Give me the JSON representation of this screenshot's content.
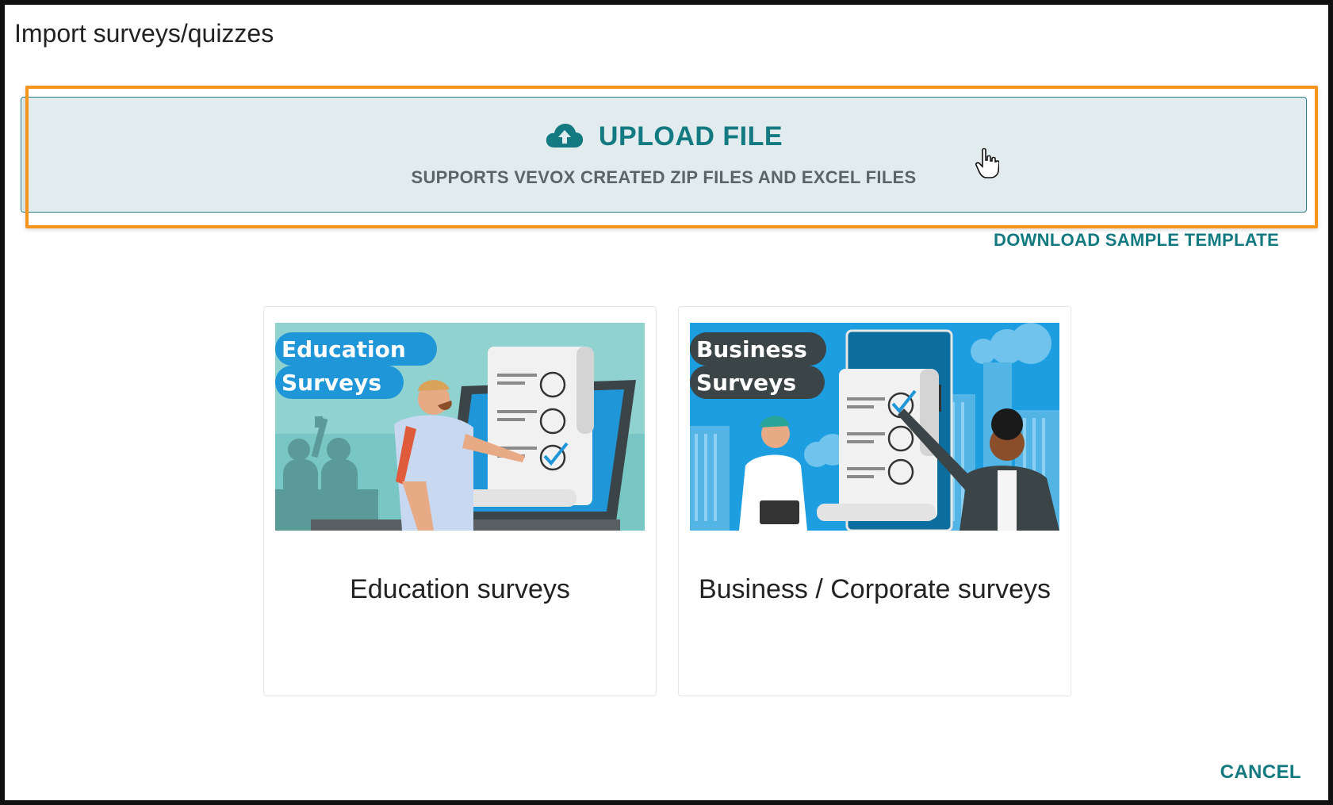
{
  "dialog": {
    "title": "Import surveys/quizzes"
  },
  "upload": {
    "title": "UPLOAD FILE",
    "subtitle": "SUPPORTS VEVOX CREATED ZIP FILES AND EXCEL FILES",
    "icon": "cloud-upload-icon"
  },
  "download_template_label": "DOWNLOAD SAMPLE TEMPLATE",
  "cards": [
    {
      "label": "Education surveys",
      "banner_line1": "Education",
      "banner_line2": "Surveys"
    },
    {
      "label": "Business / Corporate surveys",
      "banner_line1": "Business",
      "banner_line2": "Surveys"
    }
  ],
  "cancel_label": "CANCEL",
  "colors": {
    "accent": "#127a80",
    "highlight": "#f7941d",
    "upload_bg": "#e2ecef"
  }
}
